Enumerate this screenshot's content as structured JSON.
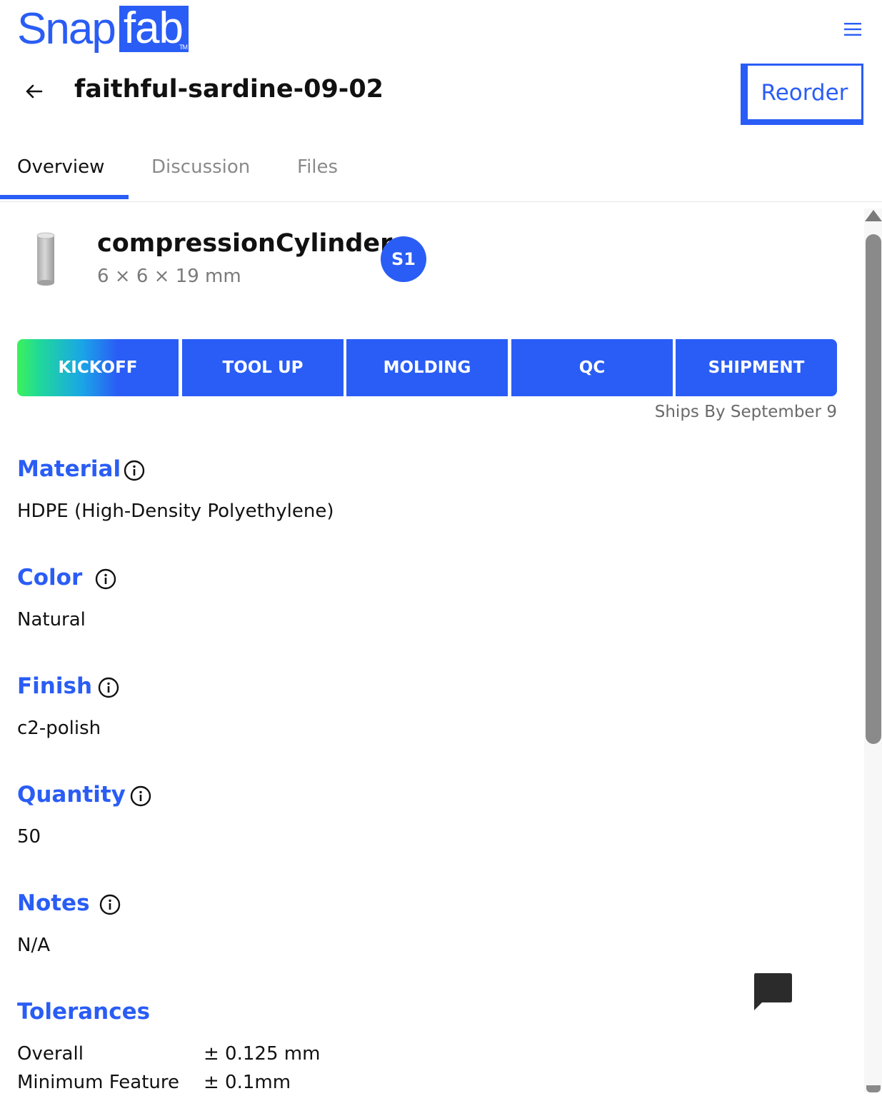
{
  "brand": {
    "word": "Snap",
    "box": "fab",
    "tm": "TM"
  },
  "header": {
    "order_id": "faithful-sardine-09-02",
    "reorder_label": "Reorder"
  },
  "tabs": [
    {
      "label": "Overview",
      "active": true
    },
    {
      "label": "Discussion",
      "active": false
    },
    {
      "label": "Files",
      "active": false
    }
  ],
  "part": {
    "name": "compressionCylinder",
    "dimensions": "6 × 6 × 19 mm",
    "badge": "S1"
  },
  "progress": {
    "stages": [
      "KICKOFF",
      "TOOL UP",
      "MOLDING",
      "QC",
      "SHIPMENT"
    ],
    "current_stage": "KICKOFF",
    "ships_by": "Ships By September 9"
  },
  "details": {
    "material": {
      "label": "Material",
      "value": "HDPE (High-Density Polyethylene)"
    },
    "color": {
      "label": "Color",
      "value": "Natural"
    },
    "finish": {
      "label": "Finish",
      "value": "c2-polish"
    },
    "quantity": {
      "label": "Quantity",
      "value": "50"
    },
    "notes": {
      "label": "Notes",
      "value": "N/A"
    }
  },
  "tolerances": {
    "label": "Tolerances",
    "rows": [
      {
        "name": "Overall",
        "value": "± 0.125 mm"
      },
      {
        "name": "Minimum Feature",
        "value": "± 0.1mm"
      }
    ]
  },
  "colors": {
    "accent": "#2a5df5",
    "muted": "#7a7a7a",
    "scrollbar": "#8a8a8a"
  },
  "icons": [
    "menu-icon",
    "back-arrow-icon",
    "info-icon",
    "chat-icon",
    "cylinder-thumbnail"
  ]
}
